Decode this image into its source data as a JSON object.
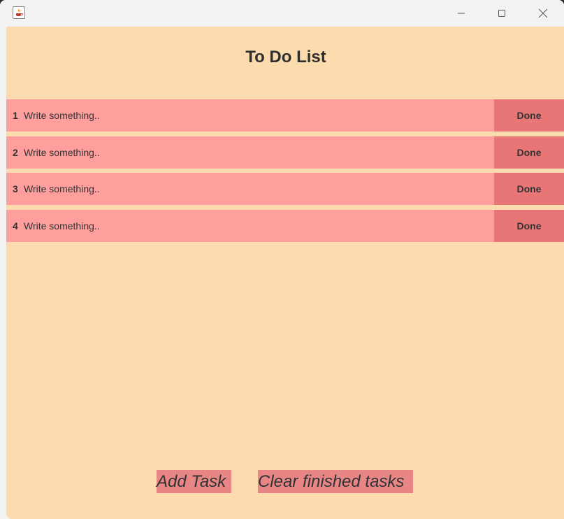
{
  "window": {
    "title": "",
    "controls": [
      "minimize-icon",
      "maximize-icon",
      "close-icon"
    ]
  },
  "app": {
    "title": "To Do List"
  },
  "tasks": [
    {
      "number": "1",
      "text": "Write something..",
      "done_label": "Done"
    },
    {
      "number": "2",
      "text": "Write something..",
      "done_label": "Done"
    },
    {
      "number": "3",
      "text": "Write something..",
      "done_label": "Done"
    },
    {
      "number": "4",
      "text": "Write something..",
      "done_label": "Done"
    }
  ],
  "footer": {
    "add_label": "Add Task",
    "clear_label": "Clear finished tasks"
  },
  "colors": {
    "background": "#fcdcae",
    "task_row": "#ff9f9d",
    "done_button": "#e87677",
    "footer_button": "#e88686",
    "text": "#333333"
  }
}
